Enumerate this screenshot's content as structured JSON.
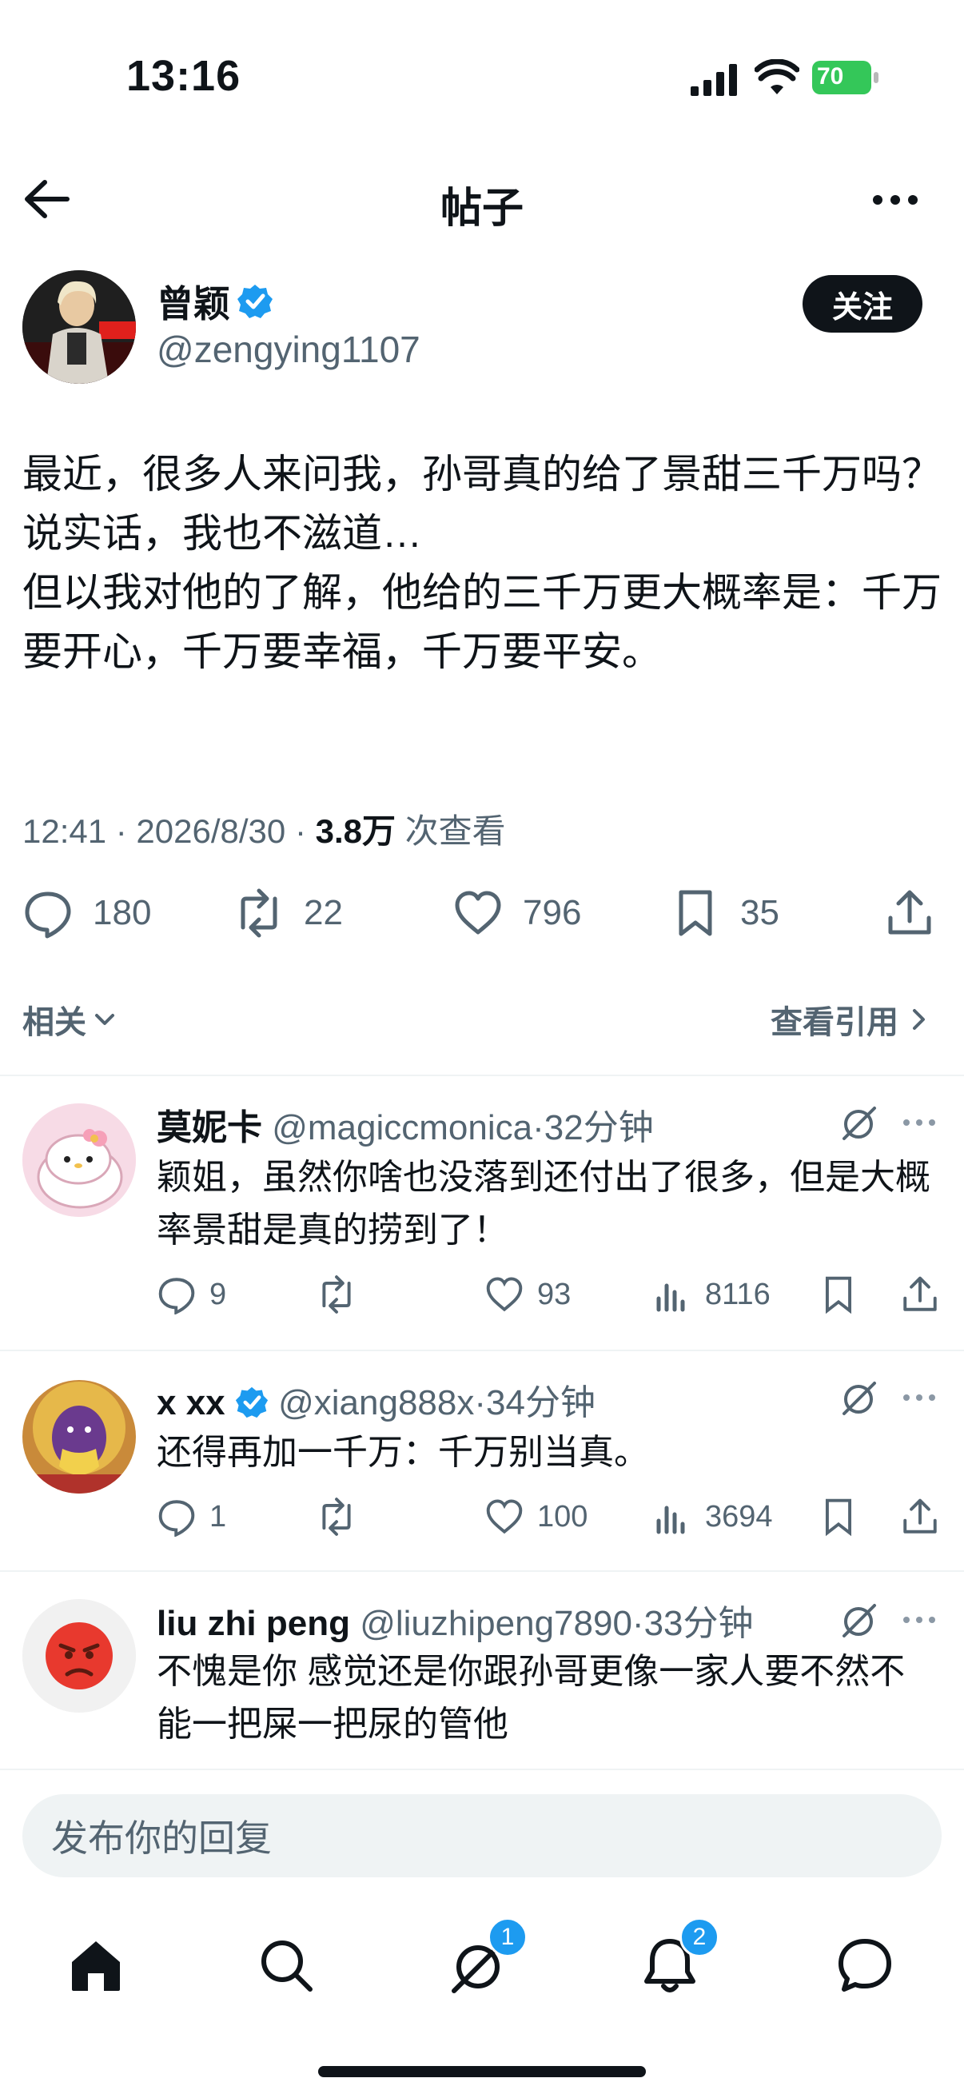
{
  "status": {
    "time": "13:16",
    "battery": "70"
  },
  "header": {
    "title": "帖子"
  },
  "author": {
    "name": "曾颖",
    "handle": "@zengying1107",
    "follow_label": "关注"
  },
  "post": {
    "text": "最近，很多人来问我，孙哥真的给了景甜三千万吗？\n说实话，我也不滋道…\n但以我对他的了解，他给的三千万更大概率是：千万要开心，千万要幸福，千万要平安。",
    "time": "12:41 · 2026/8/30 · ",
    "views_count": "3.8万",
    "views_label": " 次查看"
  },
  "actions": {
    "replies": "180",
    "reposts": "22",
    "likes": "796",
    "bookmarks": "35"
  },
  "related_label": "相关",
  "quotes_label": "查看引用",
  "replies": [
    {
      "name": "莫妮卡",
      "handle": "@magiccmonica",
      "time": "32分钟",
      "text": "颖姐，虽然你啥也没落到还付出了很多，但是大概率景甜是真的捞到了！",
      "replies": "9",
      "reposts": "",
      "likes": "93",
      "views": "8116"
    },
    {
      "name": "x xx",
      "handle": "@xiang888x",
      "time": "34分钟",
      "text": "还得再加一千万：千万别当真。",
      "replies": "1",
      "reposts": "",
      "likes": "100",
      "views": "3694"
    },
    {
      "name": "liu zhi peng",
      "handle": "@liuzhipeng7890",
      "time": "33分钟",
      "text": "不愧是你 感觉还是你跟孙哥更像一家人要不然不能一把屎一把尿的管他"
    }
  ],
  "reply_box": {
    "placeholder": "发布你的回复"
  },
  "tabbar": {
    "messages_badge": "1",
    "notifications_badge": "2"
  }
}
